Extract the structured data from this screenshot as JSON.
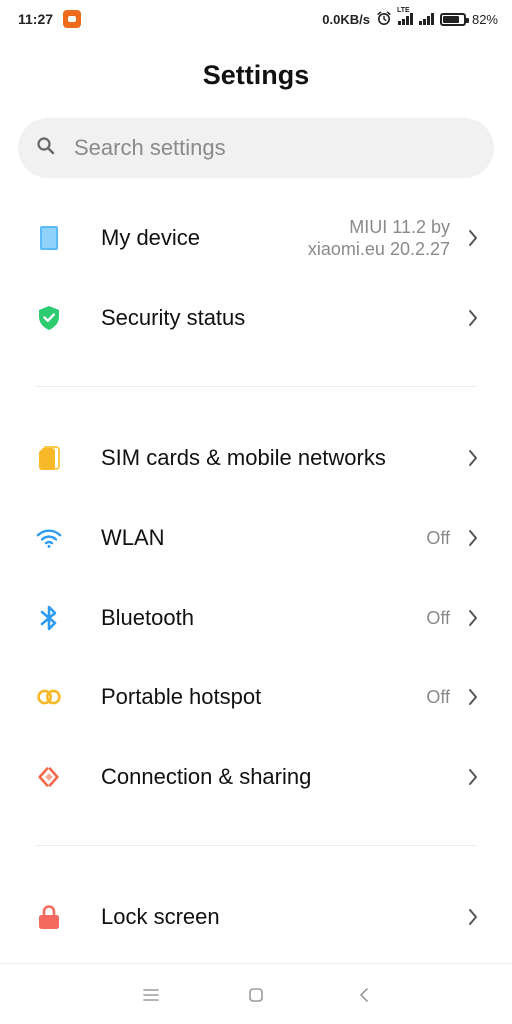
{
  "status_bar": {
    "time": "11:27",
    "net_speed": "0.0KB/s",
    "lte_label": "LTE",
    "battery_level": 0.82,
    "battery_text": "82%"
  },
  "header": {
    "title": "Settings"
  },
  "search": {
    "placeholder": "Search settings"
  },
  "items": [
    {
      "id": "my-device",
      "label": "My device",
      "value_line1": "MIUI 11.2 by",
      "value_line2": "xiaomi.eu 20.2.27",
      "icon": "device-icon",
      "color": "#4fb3f5"
    },
    {
      "id": "security-status",
      "label": "Security status",
      "icon": "shield-check-icon",
      "color": "#2ecc71"
    },
    {
      "id": "sim-cards",
      "label": "SIM cards & mobile networks",
      "icon": "sim-card-icon",
      "color": "#f7b928"
    },
    {
      "id": "wlan",
      "label": "WLAN",
      "value": "Off",
      "icon": "wifi-icon",
      "color": "#2f9bf0"
    },
    {
      "id": "bluetooth",
      "label": "Bluetooth",
      "value": "Off",
      "icon": "bluetooth-icon",
      "color": "#2f9bf0"
    },
    {
      "id": "hotspot",
      "label": "Portable hotspot",
      "value": "Off",
      "icon": "hotspot-icon",
      "color": "#f7b928"
    },
    {
      "id": "connection",
      "label": "Connection & sharing",
      "icon": "connection-sharing-icon",
      "color": "#f06a4a"
    },
    {
      "id": "lock-screen",
      "label": "Lock screen",
      "icon": "lock-icon",
      "color": "#f46a5e"
    }
  ],
  "nav_bar": {
    "icons": [
      "menu-icon",
      "home-icon",
      "back-icon"
    ]
  }
}
